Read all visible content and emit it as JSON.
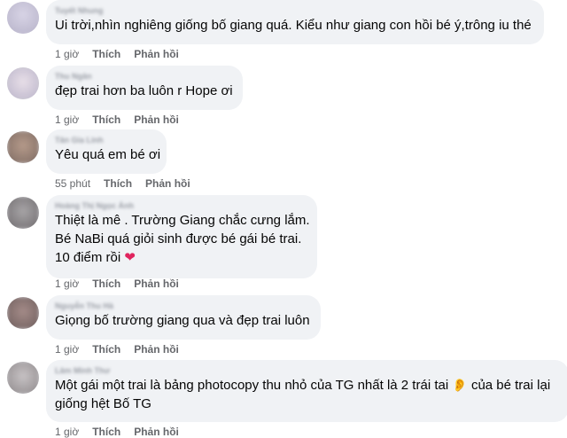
{
  "comments": [
    {
      "author": "Tuyết Nhung",
      "lines": [
        "Ui trời,nhìn nghiêng giống bố giang quá. Kiểu như giang con hồi bé ý,trông iu thé"
      ],
      "time": "1 giờ"
    },
    {
      "author": "Thu Ngân",
      "lines": [
        "đẹp trai hơn ba luôn r Hope ơi"
      ],
      "time": "1 giờ"
    },
    {
      "author": "Tân Gia Linh",
      "lines": [
        "Yêu quá em bé ơi"
      ],
      "time": "55 phút"
    },
    {
      "author": "Hoàng Thị Ngọc Ánh",
      "lines": [
        "Thiệt là mê . Trường Giang chắc cưng lắm.",
        "Bé NaBi quá giỏi sinh được bé gái bé trai.",
        "10 điểm rồi"
      ],
      "heart": "❤",
      "time": "1 giờ"
    },
    {
      "author": "Nguyễn Thu Hà",
      "lines": [
        "Giọng bố trường giang qua và đẹp trai luôn"
      ],
      "time": "1 giờ"
    },
    {
      "author": "Lâm Minh Thư",
      "lines": [
        "Một gái một trai là bảng photocopy thu nhỏ của TG nhất là 2 trái tai",
        "giống hệt Bố TG"
      ],
      "ear": "👂",
      "line1_suffix": "của bé trai lại",
      "time": "1 giờ"
    }
  ],
  "actions": {
    "like": "Thích",
    "reply": "Phản hồi"
  },
  "colors": {
    "bubble": "#f0f2f5",
    "meta": "#65676b",
    "heart": "#e0245e"
  }
}
